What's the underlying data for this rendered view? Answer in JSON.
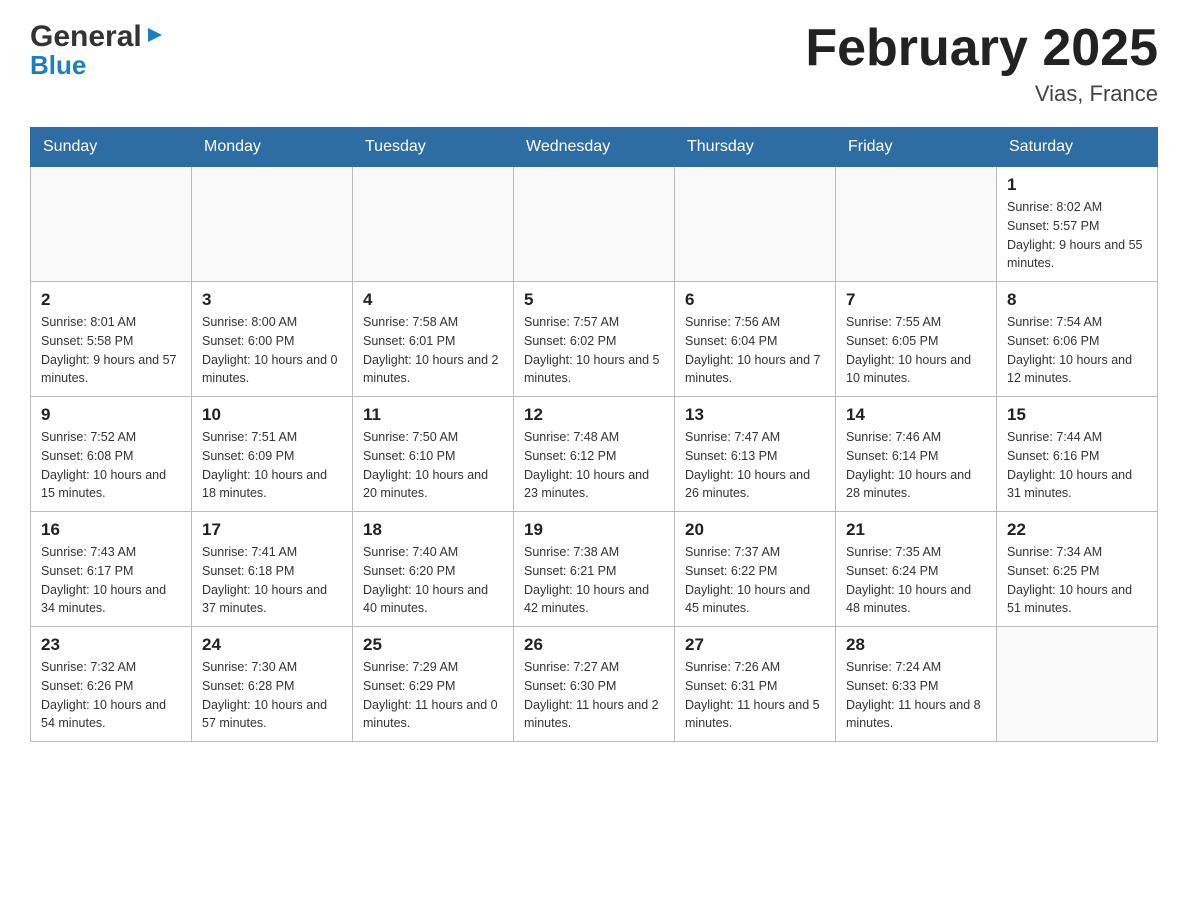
{
  "logo": {
    "general": "General",
    "blue": "Blue"
  },
  "title": "February 2025",
  "location": "Vias, France",
  "days_of_week": [
    "Sunday",
    "Monday",
    "Tuesday",
    "Wednesday",
    "Thursday",
    "Friday",
    "Saturday"
  ],
  "weeks": [
    [
      {
        "day": "",
        "info": ""
      },
      {
        "day": "",
        "info": ""
      },
      {
        "day": "",
        "info": ""
      },
      {
        "day": "",
        "info": ""
      },
      {
        "day": "",
        "info": ""
      },
      {
        "day": "",
        "info": ""
      },
      {
        "day": "1",
        "info": "Sunrise: 8:02 AM\nSunset: 5:57 PM\nDaylight: 9 hours and 55 minutes."
      }
    ],
    [
      {
        "day": "2",
        "info": "Sunrise: 8:01 AM\nSunset: 5:58 PM\nDaylight: 9 hours and 57 minutes."
      },
      {
        "day": "3",
        "info": "Sunrise: 8:00 AM\nSunset: 6:00 PM\nDaylight: 10 hours and 0 minutes."
      },
      {
        "day": "4",
        "info": "Sunrise: 7:58 AM\nSunset: 6:01 PM\nDaylight: 10 hours and 2 minutes."
      },
      {
        "day": "5",
        "info": "Sunrise: 7:57 AM\nSunset: 6:02 PM\nDaylight: 10 hours and 5 minutes."
      },
      {
        "day": "6",
        "info": "Sunrise: 7:56 AM\nSunset: 6:04 PM\nDaylight: 10 hours and 7 minutes."
      },
      {
        "day": "7",
        "info": "Sunrise: 7:55 AM\nSunset: 6:05 PM\nDaylight: 10 hours and 10 minutes."
      },
      {
        "day": "8",
        "info": "Sunrise: 7:54 AM\nSunset: 6:06 PM\nDaylight: 10 hours and 12 minutes."
      }
    ],
    [
      {
        "day": "9",
        "info": "Sunrise: 7:52 AM\nSunset: 6:08 PM\nDaylight: 10 hours and 15 minutes."
      },
      {
        "day": "10",
        "info": "Sunrise: 7:51 AM\nSunset: 6:09 PM\nDaylight: 10 hours and 18 minutes."
      },
      {
        "day": "11",
        "info": "Sunrise: 7:50 AM\nSunset: 6:10 PM\nDaylight: 10 hours and 20 minutes."
      },
      {
        "day": "12",
        "info": "Sunrise: 7:48 AM\nSunset: 6:12 PM\nDaylight: 10 hours and 23 minutes."
      },
      {
        "day": "13",
        "info": "Sunrise: 7:47 AM\nSunset: 6:13 PM\nDaylight: 10 hours and 26 minutes."
      },
      {
        "day": "14",
        "info": "Sunrise: 7:46 AM\nSunset: 6:14 PM\nDaylight: 10 hours and 28 minutes."
      },
      {
        "day": "15",
        "info": "Sunrise: 7:44 AM\nSunset: 6:16 PM\nDaylight: 10 hours and 31 minutes."
      }
    ],
    [
      {
        "day": "16",
        "info": "Sunrise: 7:43 AM\nSunset: 6:17 PM\nDaylight: 10 hours and 34 minutes."
      },
      {
        "day": "17",
        "info": "Sunrise: 7:41 AM\nSunset: 6:18 PM\nDaylight: 10 hours and 37 minutes."
      },
      {
        "day": "18",
        "info": "Sunrise: 7:40 AM\nSunset: 6:20 PM\nDaylight: 10 hours and 40 minutes."
      },
      {
        "day": "19",
        "info": "Sunrise: 7:38 AM\nSunset: 6:21 PM\nDaylight: 10 hours and 42 minutes."
      },
      {
        "day": "20",
        "info": "Sunrise: 7:37 AM\nSunset: 6:22 PM\nDaylight: 10 hours and 45 minutes."
      },
      {
        "day": "21",
        "info": "Sunrise: 7:35 AM\nSunset: 6:24 PM\nDaylight: 10 hours and 48 minutes."
      },
      {
        "day": "22",
        "info": "Sunrise: 7:34 AM\nSunset: 6:25 PM\nDaylight: 10 hours and 51 minutes."
      }
    ],
    [
      {
        "day": "23",
        "info": "Sunrise: 7:32 AM\nSunset: 6:26 PM\nDaylight: 10 hours and 54 minutes."
      },
      {
        "day": "24",
        "info": "Sunrise: 7:30 AM\nSunset: 6:28 PM\nDaylight: 10 hours and 57 minutes."
      },
      {
        "day": "25",
        "info": "Sunrise: 7:29 AM\nSunset: 6:29 PM\nDaylight: 11 hours and 0 minutes."
      },
      {
        "day": "26",
        "info": "Sunrise: 7:27 AM\nSunset: 6:30 PM\nDaylight: 11 hours and 2 minutes."
      },
      {
        "day": "27",
        "info": "Sunrise: 7:26 AM\nSunset: 6:31 PM\nDaylight: 11 hours and 5 minutes."
      },
      {
        "day": "28",
        "info": "Sunrise: 7:24 AM\nSunset: 6:33 PM\nDaylight: 11 hours and 8 minutes."
      },
      {
        "day": "",
        "info": ""
      }
    ]
  ]
}
